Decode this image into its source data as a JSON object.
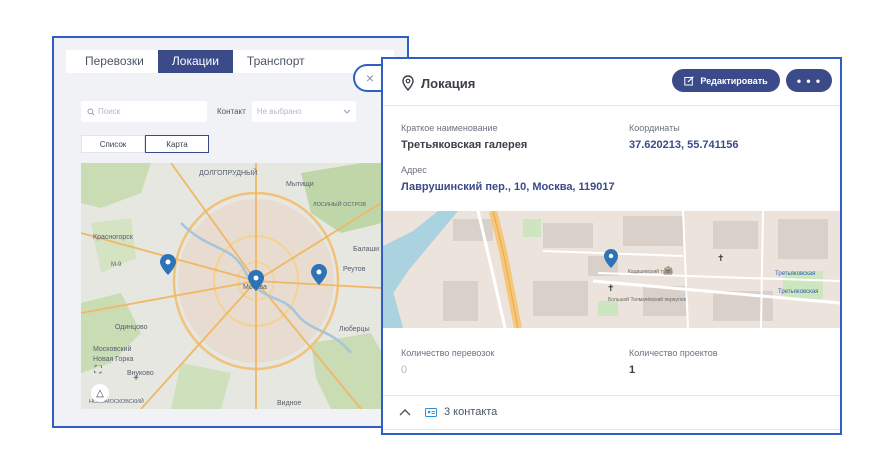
{
  "tabs": [
    {
      "label": "Перевозки"
    },
    {
      "label": "Локации"
    },
    {
      "label": "Транспорт"
    }
  ],
  "filters": {
    "search_placeholder": "Поиск",
    "contact_label": "Контакт",
    "contact_value": "Не выбрано"
  },
  "view_toggle": {
    "list_label": "Список",
    "map_label": "Карта"
  },
  "big_map": {
    "labels": [
      "ДОЛГОПРУДНЫЙ",
      "Мытищи",
      "Красногорск",
      "Москва",
      "Реутов",
      "Одинцово",
      "Люберцы",
      "Видное",
      "Балаши",
      "Московский",
      "Новая Горка",
      "Внуково",
      "М-9",
      "ЛОСИНЫЙ ОСТРОВ",
      "НОВОМОСКОВСКИЙ"
    ]
  },
  "card": {
    "title": "Локация",
    "edit_label": "Редактировать",
    "more_label": "• • •",
    "short_name_label": "Краткое наименование",
    "short_name_value": "Третьяковская галерея",
    "coords_label": "Координаты",
    "coords_value": "37.620213, 55.741156",
    "address_label": "Адрес",
    "address_value": "Лаврушинский пер., 10, Москва, 119017",
    "shipments_label": "Количество перевозок",
    "shipments_value": "0",
    "projects_label": "Количество проектов",
    "projects_value": "1",
    "contacts_label": "3 контакта"
  },
  "small_map": {
    "labels": [
      "Третьяковская",
      "Третьяковская",
      "Большой Толмачёвский переулок",
      "Кадашевский тупик"
    ]
  },
  "close_label": "×",
  "colors": {
    "accent": "#3b4a88",
    "frame": "#2f5fc4",
    "pin": "#2e72b8"
  }
}
